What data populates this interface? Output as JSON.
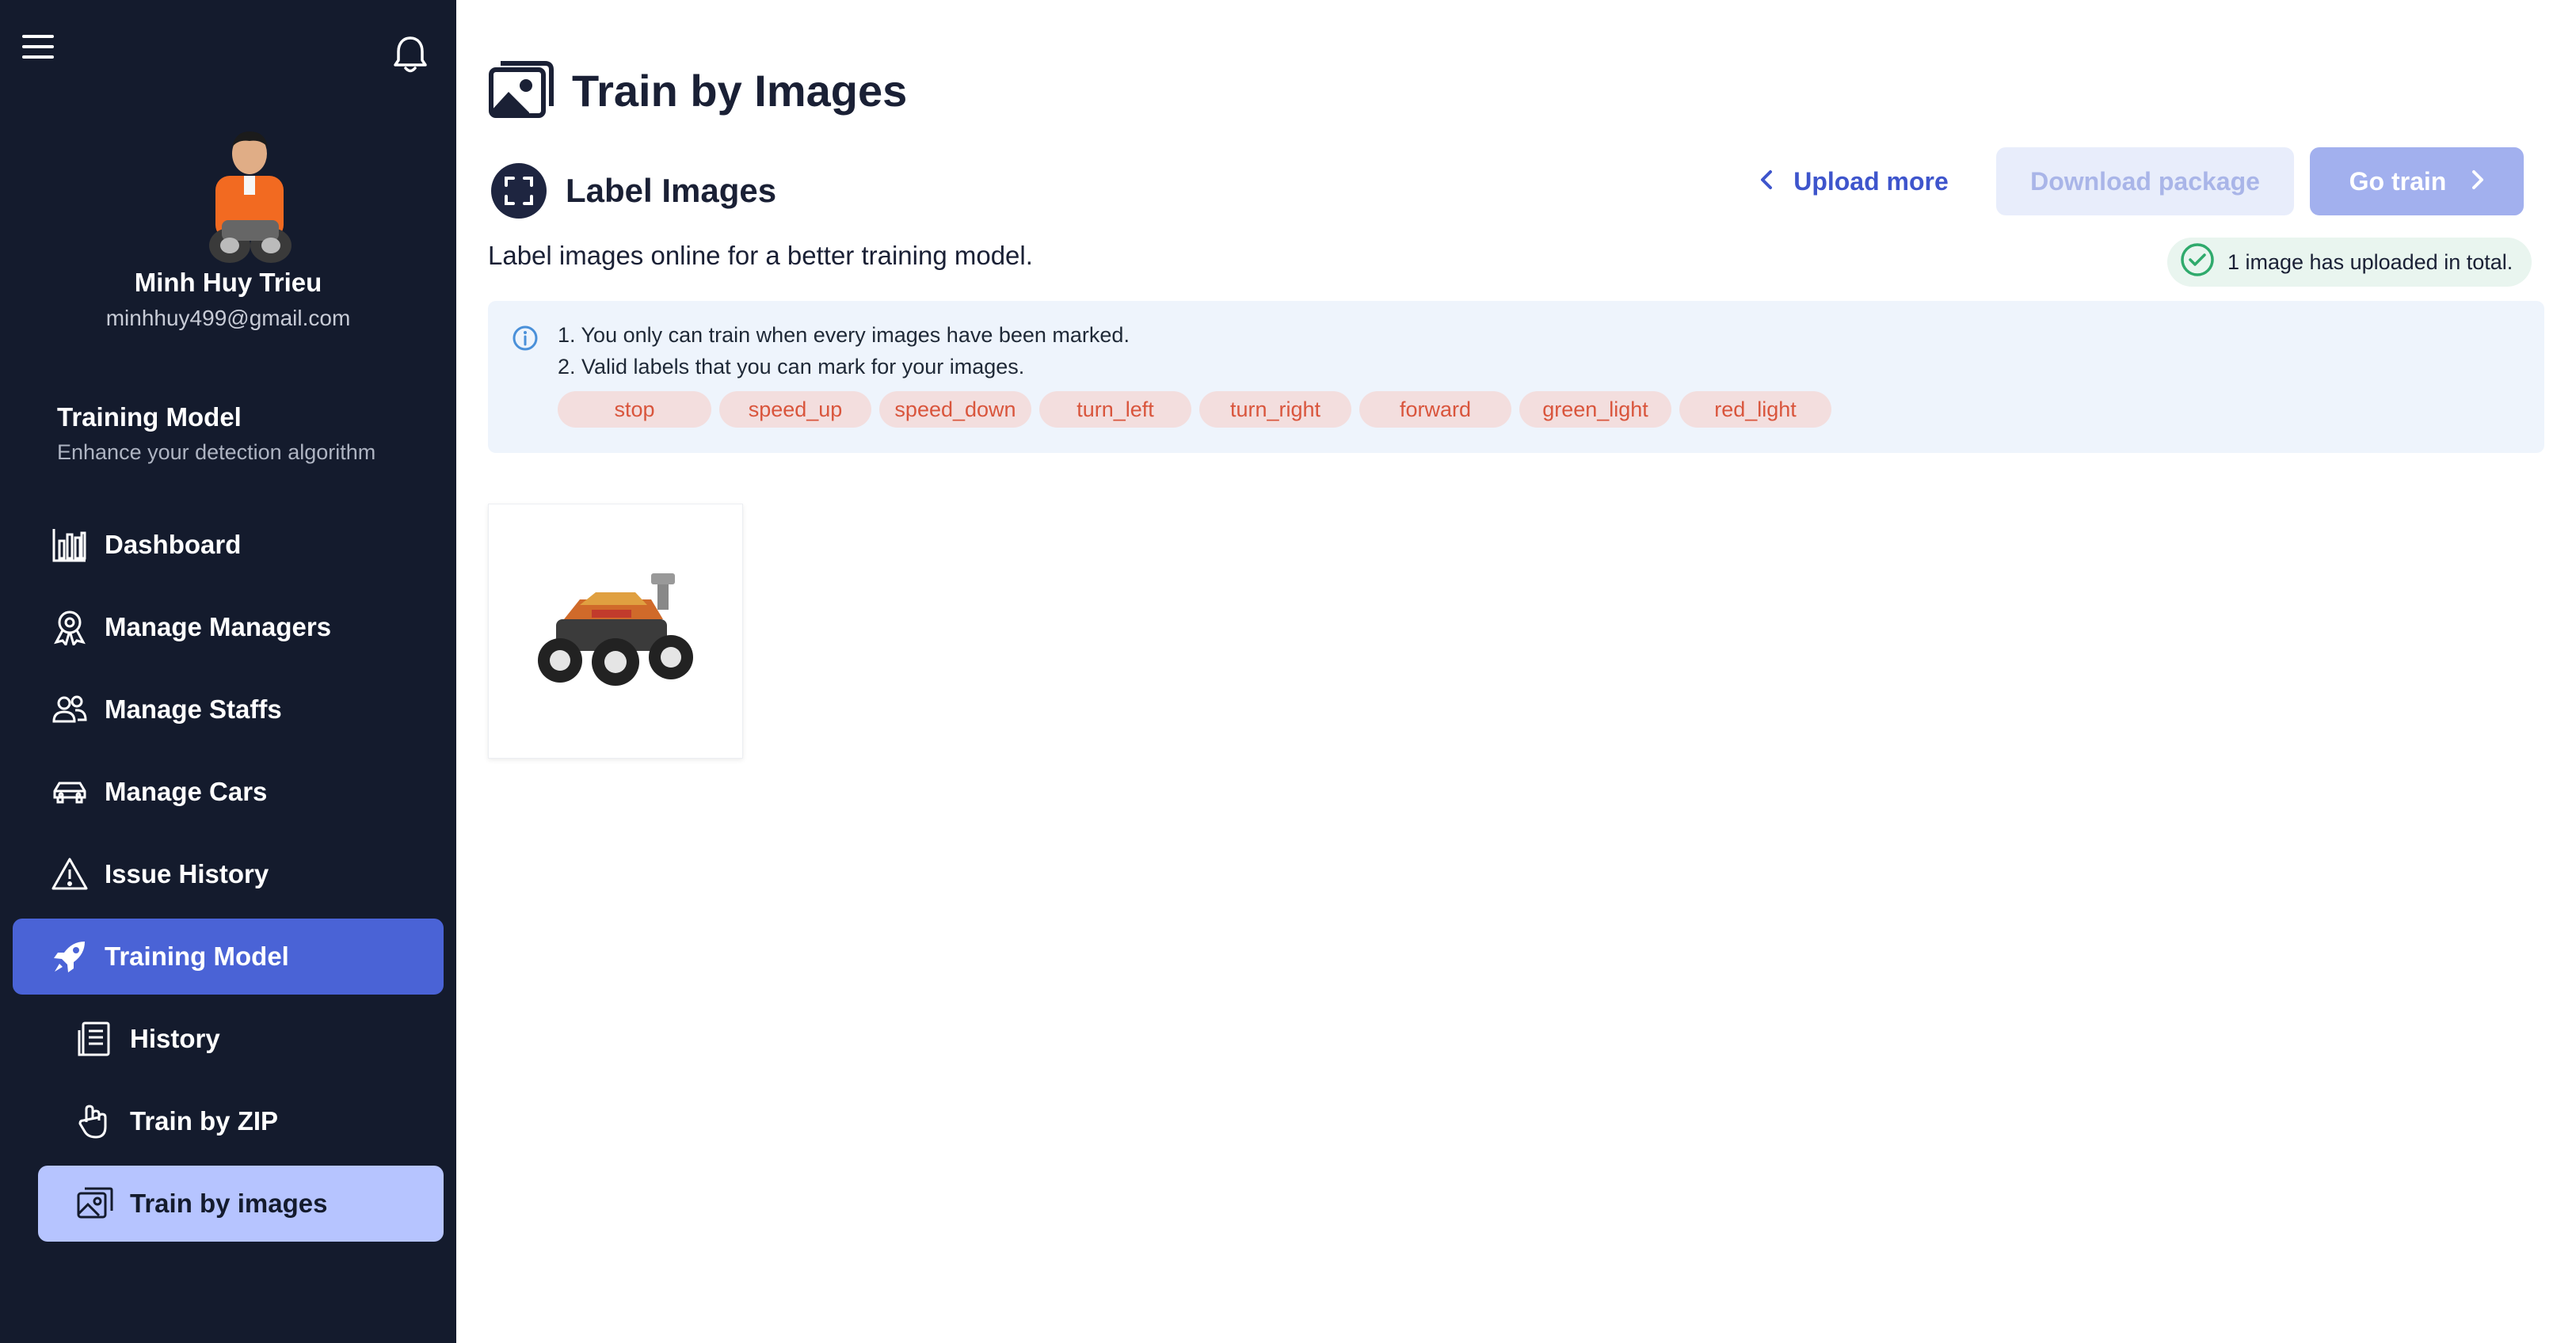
{
  "sidebar": {
    "user": {
      "name": "Minh Huy Trieu",
      "email": "minhhuy499@gmail.com"
    },
    "section": {
      "title": "Training Model",
      "subtitle": "Enhance your detection algorithm"
    },
    "nav": [
      {
        "label": "Dashboard",
        "icon": "bar-chart-icon"
      },
      {
        "label": "Manage Managers",
        "icon": "award-icon"
      },
      {
        "label": "Manage Staffs",
        "icon": "users-icon"
      },
      {
        "label": "Manage Cars",
        "icon": "car-icon"
      },
      {
        "label": "Issue History",
        "icon": "warning-icon"
      },
      {
        "label": "Training Model",
        "icon": "rocket-icon",
        "active": true
      }
    ],
    "subnav": [
      {
        "label": "History",
        "icon": "list-doc-icon"
      },
      {
        "label": "Train by ZIP",
        "icon": "hand-icon"
      },
      {
        "label": "Train by images",
        "icon": "images-icon",
        "current": true
      }
    ]
  },
  "main": {
    "page_title": "Train by Images",
    "label_title": "Label Images",
    "label_description": "Label images online for a better training model.",
    "buttons": {
      "upload_more": "Upload more",
      "download_package": "Download package",
      "go_train": "Go train"
    },
    "upload_status": "1 image has uploaded in total.",
    "info": {
      "line1": "1. You only can train when every images have been marked.",
      "line2": "2. Valid labels that you can mark for your images."
    },
    "labels": [
      "stop",
      "speed_up",
      "speed_down",
      "turn_left",
      "turn_right",
      "forward",
      "green_light",
      "red_light"
    ],
    "images_count": 1
  },
  "colors": {
    "sidebar_bg": "#141b2d",
    "active_nav": "#4a63d6",
    "current_subnav": "#b6c4ff",
    "tag_bg": "#f3dede",
    "tag_text": "#d9553c",
    "accent": "#3e55cc"
  }
}
